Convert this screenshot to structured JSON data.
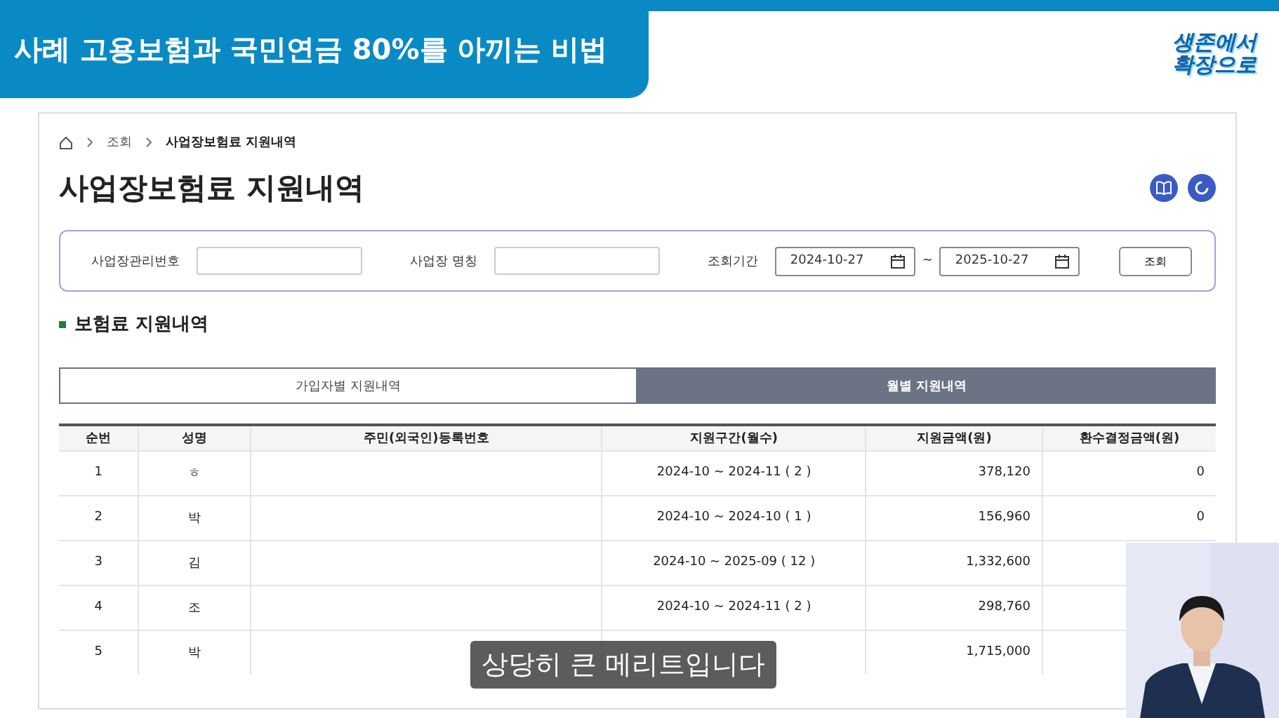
{
  "banner": {
    "title": "사례 고용보험과 국민연금 80%를 아끼는 비법",
    "logo_lines": [
      "생존에서",
      "확장으로"
    ]
  },
  "breadcrumb": [
    "조회",
    "사업장보험료 지원내역"
  ],
  "page_title": "사업장보험료 지원내역",
  "search": {
    "fields": [
      {
        "label": "사업장관리번호",
        "kind": "text"
      },
      {
        "label": "사업장 명칭",
        "kind": "text"
      }
    ],
    "period_label": "조회기간",
    "date_from": "2024-10-27",
    "separator": "~",
    "date_to": "2025-10-27",
    "button": "조회"
  },
  "section_title": "보험료 지원내역",
  "tabs": [
    {
      "label": "가입자별 지원내역",
      "selected": false
    },
    {
      "label": "월별 지원내역",
      "selected": true
    }
  ],
  "table": {
    "columns": [
      "순번",
      "성명",
      "주민(외국인)등록번호",
      "지원구간(월수)",
      "지원금액(원)",
      "환수결정금액(원)"
    ],
    "rows": [
      {
        "no": "1",
        "name": "ㅎ",
        "period": "2024-10 ~ 2024-11 ( 2 )",
        "amount": "378,120",
        "refund": "0"
      },
      {
        "no": "2",
        "name": "박",
        "period": "2024-10 ~ 2024-10 ( 1 )",
        "amount": "156,960",
        "refund": "0"
      },
      {
        "no": "3",
        "name": "김",
        "period": "2024-10 ~ 2025-09 ( 12 )",
        "amount": "1,332,600"
      },
      {
        "no": "4",
        "name": "조",
        "period": "2024-10 ~ 2024-11 ( 2 )",
        "amount": "298,760"
      },
      {
        "no": "5",
        "name": "박",
        "amount": "1,715,000"
      }
    ]
  },
  "subtitle": "상당히 큰 메리트입니다"
}
